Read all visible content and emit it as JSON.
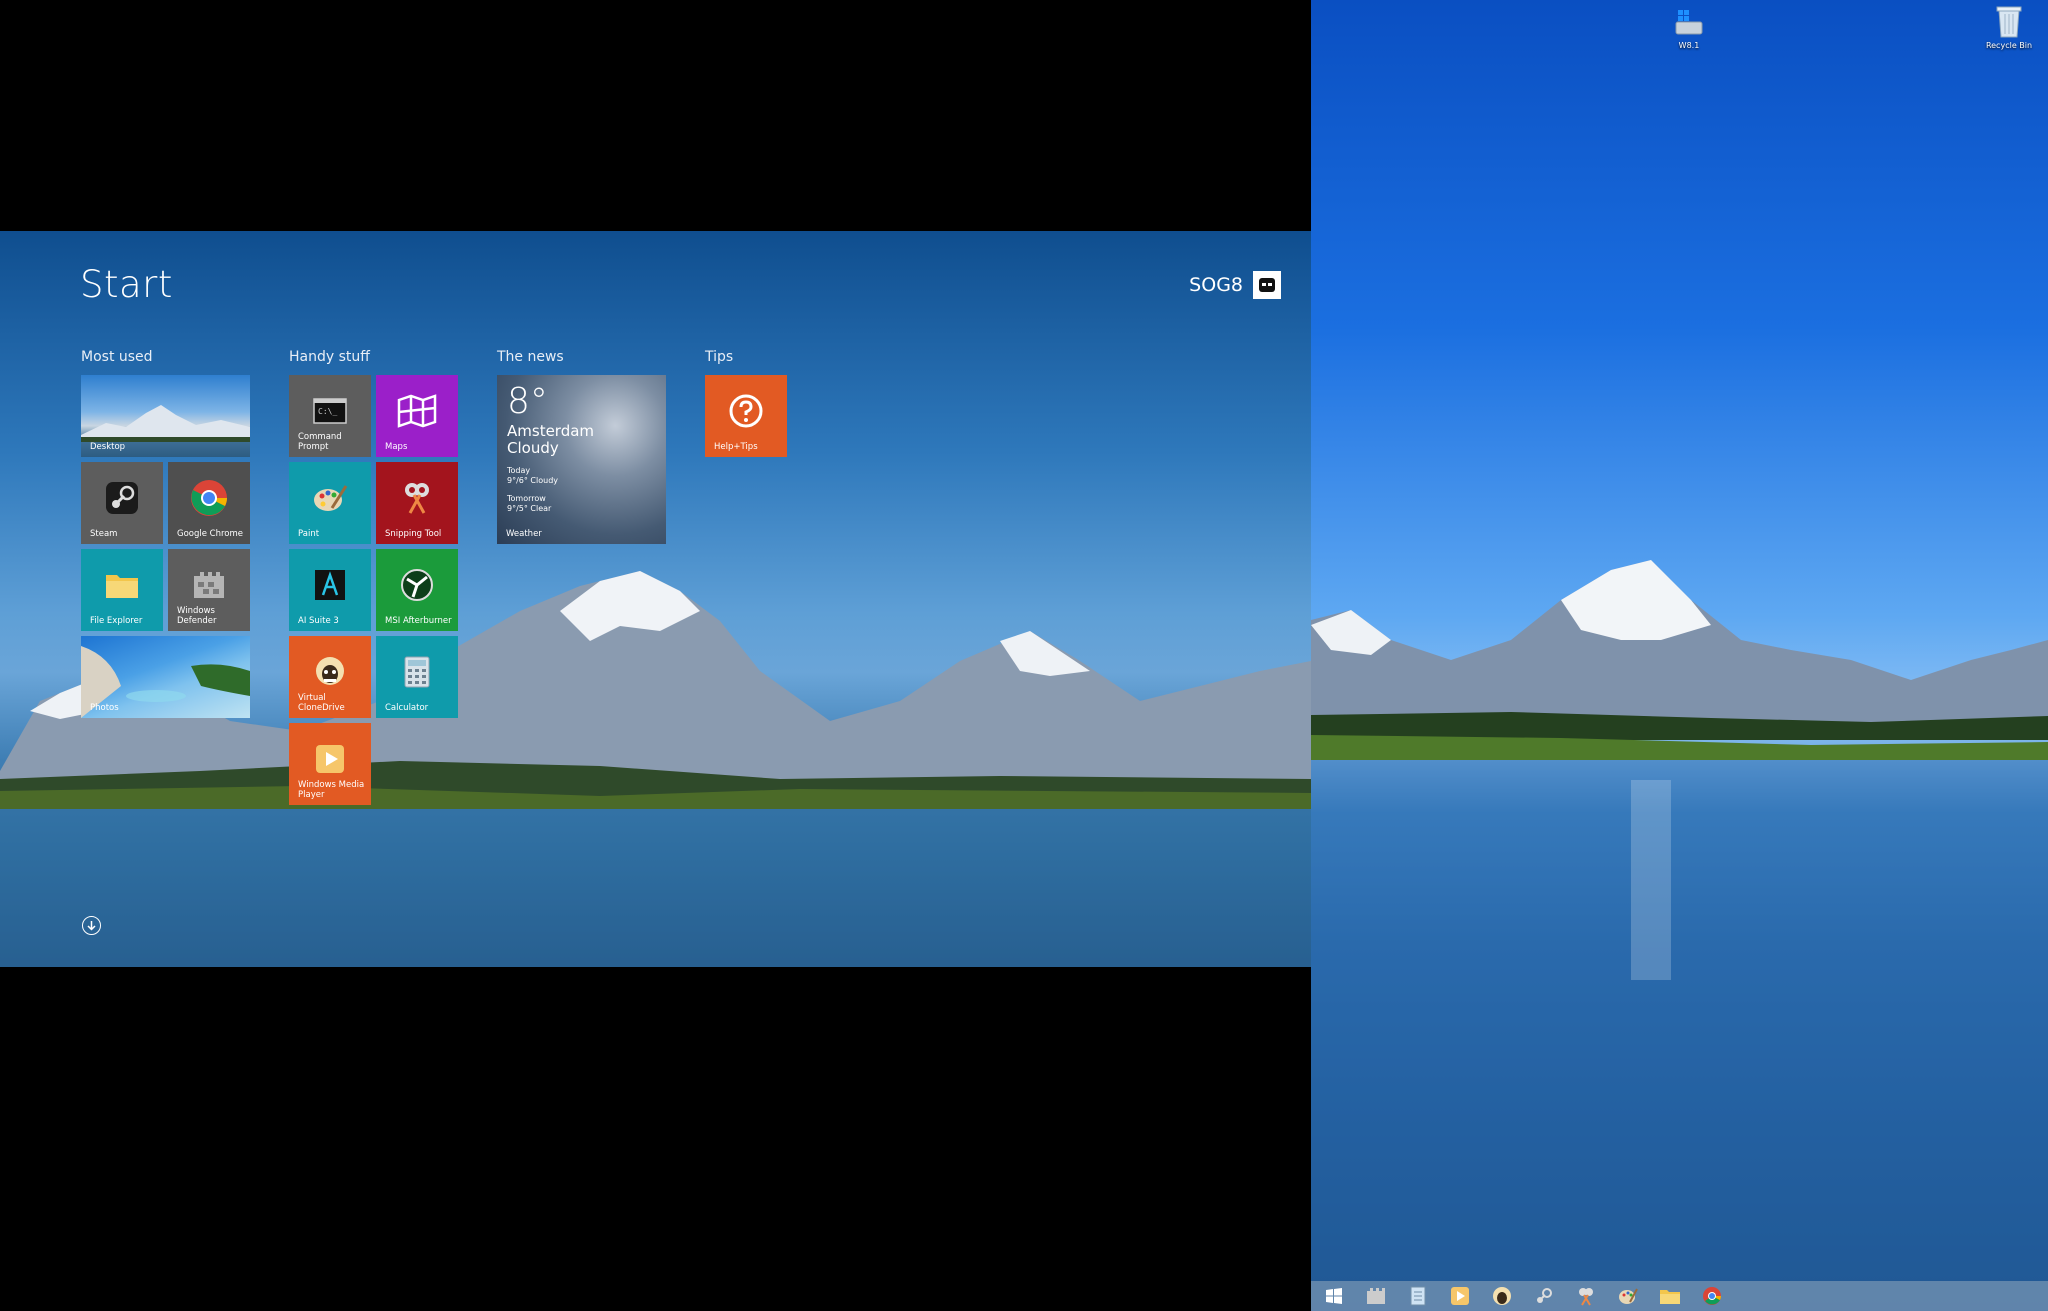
{
  "start": {
    "title": "Start",
    "user": {
      "name": "SOG8"
    },
    "groups": {
      "most_used": "Most used",
      "handy_stuff": "Handy stuff",
      "the_news": "The news",
      "tips": "Tips"
    },
    "tiles": {
      "desktop": "Desktop",
      "steam": "Steam",
      "chrome": "Google Chrome",
      "file_explorer": "File Explorer",
      "defender": "Windows Defender",
      "photos": "Photos",
      "cmd": "Command Prompt",
      "maps": "Maps",
      "paint": "Paint",
      "snipping": "Snipping Tool",
      "ai_suite": "AI Suite 3",
      "afterburner": "MSI Afterburner",
      "clonedrive": "Virtual CloneDrive",
      "calculator": "Calculator",
      "wmp": "Windows Media Player",
      "help": "Help+Tips"
    },
    "weather": {
      "temp": "8°",
      "city": "Amsterdam",
      "condition": "Cloudy",
      "today_label": "Today",
      "today_detail": "9°/6° Cloudy",
      "tomorrow_label": "Tomorrow",
      "tomorrow_detail": "9°/5° Clear",
      "app_name": "Weather"
    }
  },
  "desktop": {
    "icons": {
      "w81": "W8.1",
      "recycle_bin": "Recycle Bin"
    }
  },
  "colors": {
    "tile_orange": "#e25a23",
    "tile_purple": "#9b1fc9",
    "tile_red": "#a3141d",
    "tile_green": "#1b9b3b",
    "tile_teal": "#0f9bab",
    "tile_gray": "#5d5d5d"
  }
}
